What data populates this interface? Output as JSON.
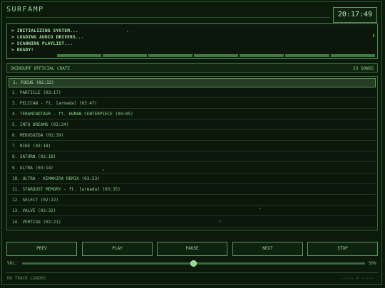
{
  "app": {
    "title": "SURFAMP",
    "clock": "20:17:49"
  },
  "console": {
    "lines": [
      "> INITIALIZING SYSTEM...",
      "> LOADING AUDIO DRIVERS...",
      "> SCANNING PLAYLIST...",
      "> READY!"
    ],
    "progress_segments": 7
  },
  "crate": {
    "name": "SKINSURF OFFICIAL CRATE",
    "count": "23 SONGS"
  },
  "playlist": {
    "selected_index": 0,
    "tracks": [
      "1. FOCUS (02:32)",
      "2. PARTICLE (03:17)",
      "3. PELICAN - ft. [armada] (03:47)",
      "4. TERAMINOTAUR - ft. HUMAN CENTERPIECE (04:05)",
      "5. INTO DREAMS (02:34)",
      "6. MEDUSOZOA (01:39)",
      "7. RIDE (02:18)",
      "8. SATURN (02:18)",
      "9. ULTRA (03:14)",
      "10. ULTRA - KIMAKIRA REMIX (03:53)",
      "11. STARDUST MEMORY - ft. [armada] (03:35)",
      "12. SELECT (02:22)",
      "13. VALVE (03:32)",
      "14. VERTIGO (02:21)"
    ]
  },
  "controls": {
    "prev": "PREV",
    "play": "PLAY",
    "pause": "PAUSE",
    "next": "NEXT",
    "stop": "STOP"
  },
  "volume": {
    "label": "VOL:",
    "percent_text": "50%",
    "value": 0.5
  },
  "status": {
    "text": "NO TRACK LOADED",
    "time": "--:-- / --:--"
  },
  "colors": {
    "background": "#0c1a0c",
    "accent": "#7fc97f",
    "highlight": "#243d24"
  }
}
